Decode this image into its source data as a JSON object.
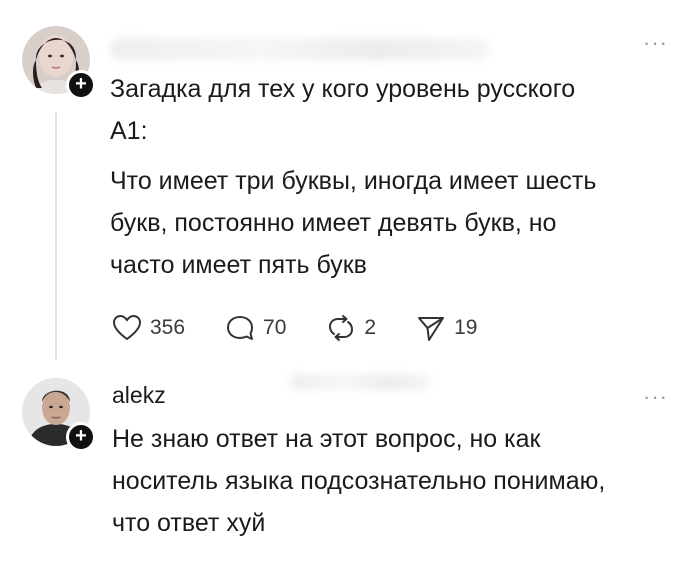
{
  "post1": {
    "title": "Загадка для тех у кого уровень русского\nА1:",
    "body": "Что имеет три буквы, иногда имеет шесть\nбукв, постоянно имеет девять букв, но\nчасто имеет пять букв",
    "more": "···",
    "actions": {
      "likes": "356",
      "comments": "70",
      "reposts": "2",
      "shares": "19"
    },
    "icons": {
      "like": "heart-icon",
      "comment": "comment-bubble-icon",
      "repost": "repost-icon",
      "share": "send-icon"
    }
  },
  "reply": {
    "username": "alekz",
    "more": "···",
    "text": "Не знаю ответ на этот вопрос, но как\nноситель языка подсознательно понимаю,\nчто ответ хуй"
  },
  "colors": {
    "text": "#1b1b1b",
    "muted": "#9a9a9a",
    "line": "#e3e3e3"
  }
}
